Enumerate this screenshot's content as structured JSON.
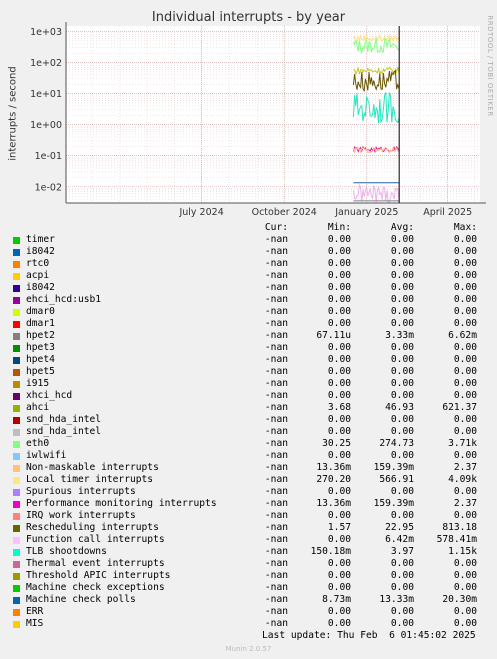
{
  "colors": {
    "background": "#f0f0f0",
    "plot_bg": "#ffffff",
    "grid_minor": "#e6c8c8",
    "grid_major": "#c8a0a0",
    "axis": "#555555",
    "now_line": "#000000"
  },
  "chart_data": {
    "type": "line",
    "title": "Individual interrupts - by year",
    "ylabel": "interrupts / second",
    "yscale": "log",
    "ylim": [
      0.003,
      1500
    ],
    "y_ticks": [
      "1e+03",
      "1e+02",
      "1e+01",
      "1e+00",
      "1e-01",
      "1e-02"
    ],
    "y_tick_values": [
      1000,
      100,
      10,
      1,
      0.1,
      0.01
    ],
    "x_ticks": [
      "July 2024",
      "October 2024",
      "January 2025",
      "April 2025"
    ],
    "x_tick_dates": [
      "2024-07-01",
      "2024-10-01",
      "2025-01-01",
      "2025-04-01"
    ],
    "xlim": [
      "2024-02-01",
      "2025-05-07"
    ],
    "data_start": "2024-12-17",
    "now": "2025-02-06",
    "grid": true,
    "series": [
      {
        "name": "eth0",
        "color": "#80ff80",
        "level": 350,
        "amp": 0.25
      },
      {
        "name": "ahci",
        "color": "#c8c830",
        "level": 55,
        "amp": 0.12
      },
      {
        "name": "Local timer interrupts",
        "color": "#ffe080",
        "level": 600,
        "amp": 0.1
      },
      {
        "name": "Rescheduling interrupts",
        "color": "#665500",
        "level": 25,
        "amp": 0.35
      },
      {
        "name": "TLB shootdowns",
        "color": "#20e8c0",
        "level": 3.5,
        "amp": 0.5
      },
      {
        "name": "Performance monitoring interrupts",
        "color": "#e020a0",
        "level": 0.16,
        "amp": 0.08
      },
      {
        "name": "Non-maskable interrupts",
        "color": "#ffc090",
        "level": 0.15,
        "amp": 0.08
      },
      {
        "name": "Machine check polls",
        "color": "#2060a0",
        "level": 0.0135,
        "amp": 0.0
      },
      {
        "name": "Function call interrupts",
        "color": "#f0b0f0",
        "level": 0.006,
        "amp": 0.3
      },
      {
        "name": "hpet2",
        "color": "#808080",
        "level": 0.0035,
        "amp": 0.0
      }
    ]
  },
  "legend": {
    "headers": {
      "cur": "Cur:",
      "min": "Min:",
      "avg": "Avg:",
      "max": "Max:"
    },
    "rows": [
      {
        "name": "timer",
        "color": "#00cc00",
        "cur": "-nan",
        "min": "0.00",
        "avg": "0.00",
        "max": "0.00"
      },
      {
        "name": "i8042",
        "color": "#0066b3",
        "cur": "-nan",
        "min": "0.00",
        "avg": "0.00",
        "max": "0.00"
      },
      {
        "name": "rtc0",
        "color": "#ff8000",
        "cur": "-nan",
        "min": "0.00",
        "avg": "0.00",
        "max": "0.00"
      },
      {
        "name": "acpi",
        "color": "#ffcc00",
        "cur": "-nan",
        "min": "0.00",
        "avg": "0.00",
        "max": "0.00"
      },
      {
        "name": "i8042",
        "color": "#330099",
        "cur": "-nan",
        "min": "0.00",
        "avg": "0.00",
        "max": "0.00"
      },
      {
        "name": "ehci_hcd:usb1",
        "color": "#990099",
        "cur": "-nan",
        "min": "0.00",
        "avg": "0.00",
        "max": "0.00"
      },
      {
        "name": "dmar0",
        "color": "#ccff00",
        "cur": "-nan",
        "min": "0.00",
        "avg": "0.00",
        "max": "0.00"
      },
      {
        "name": "dmar1",
        "color": "#ff0000",
        "cur": "-nan",
        "min": "0.00",
        "avg": "0.00",
        "max": "0.00"
      },
      {
        "name": "hpet2",
        "color": "#808080",
        "cur": "-nan",
        "min": "67.11u",
        "avg": "3.33m",
        "max": "6.62m"
      },
      {
        "name": "hpet3",
        "color": "#008f00",
        "cur": "-nan",
        "min": "0.00",
        "avg": "0.00",
        "max": "0.00"
      },
      {
        "name": "hpet4",
        "color": "#00487d",
        "cur": "-nan",
        "min": "0.00",
        "avg": "0.00",
        "max": "0.00"
      },
      {
        "name": "hpet5",
        "color": "#b35a00",
        "cur": "-nan",
        "min": "0.00",
        "avg": "0.00",
        "max": "0.00"
      },
      {
        "name": "i915",
        "color": "#b38f00",
        "cur": "-nan",
        "min": "0.00",
        "avg": "0.00",
        "max": "0.00"
      },
      {
        "name": "xhci_hcd",
        "color": "#6b006b",
        "cur": "-nan",
        "min": "0.00",
        "avg": "0.00",
        "max": "0.00"
      },
      {
        "name": "ahci",
        "color": "#8fb300",
        "cur": "-nan",
        "min": "3.68",
        "avg": "46.93",
        "max": "621.37"
      },
      {
        "name": "snd_hda_intel",
        "color": "#b30000",
        "cur": "-nan",
        "min": "0.00",
        "avg": "0.00",
        "max": "0.00"
      },
      {
        "name": "snd_hda_intel",
        "color": "#bebebe",
        "cur": "-nan",
        "min": "0.00",
        "avg": "0.00",
        "max": "0.00"
      },
      {
        "name": "eth0",
        "color": "#80ff80",
        "cur": "-nan",
        "min": "30.25",
        "avg": "274.73",
        "max": "3.71k"
      },
      {
        "name": "iwlwifi",
        "color": "#80c9ff",
        "cur": "-nan",
        "min": "0.00",
        "avg": "0.00",
        "max": "0.00"
      },
      {
        "name": "Non-maskable interrupts",
        "color": "#ffc080",
        "cur": "-nan",
        "min": "13.36m",
        "avg": "159.39m",
        "max": "2.37"
      },
      {
        "name": "Local timer interrupts",
        "color": "#ffe680",
        "cur": "-nan",
        "min": "270.20",
        "avg": "566.91",
        "max": "4.09k"
      },
      {
        "name": "Spurious interrupts",
        "color": "#aa80ff",
        "cur": "-nan",
        "min": "0.00",
        "avg": "0.00",
        "max": "0.00"
      },
      {
        "name": "Performance monitoring interrupts",
        "color": "#ee00cc",
        "cur": "-nan",
        "min": "13.36m",
        "avg": "159.39m",
        "max": "2.37"
      },
      {
        "name": "IRQ work interrupts",
        "color": "#ff8080",
        "cur": "-nan",
        "min": "0.00",
        "avg": "0.00",
        "max": "0.00"
      },
      {
        "name": "Rescheduling interrupts",
        "color": "#666600",
        "cur": "-nan",
        "min": "1.57",
        "avg": "22.95",
        "max": "813.18"
      },
      {
        "name": "Function call interrupts",
        "color": "#ffbfff",
        "cur": "-nan",
        "min": "0.00",
        "avg": "6.42m",
        "max": "578.41m"
      },
      {
        "name": "TLB shootdowns",
        "color": "#00ffcc",
        "cur": "-nan",
        "min": "150.18m",
        "avg": "3.97",
        "max": "1.15k"
      },
      {
        "name": "Thermal event interrupts",
        "color": "#cc6699",
        "cur": "-nan",
        "min": "0.00",
        "avg": "0.00",
        "max": "0.00"
      },
      {
        "name": "Threshold APIC interrupts",
        "color": "#999900",
        "cur": "-nan",
        "min": "0.00",
        "avg": "0.00",
        "max": "0.00"
      },
      {
        "name": "Machine check exceptions",
        "color": "#00cc00",
        "cur": "-nan",
        "min": "0.00",
        "avg": "0.00",
        "max": "0.00"
      },
      {
        "name": "Machine check polls",
        "color": "#0066b3",
        "cur": "-nan",
        "min": "8.73m",
        "avg": "13.33m",
        "max": "20.30m"
      },
      {
        "name": "ERR",
        "color": "#ff8000",
        "cur": "-nan",
        "min": "0.00",
        "avg": "0.00",
        "max": "0.00"
      },
      {
        "name": "MIS",
        "color": "#ffcc00",
        "cur": "-nan",
        "min": "0.00",
        "avg": "0.00",
        "max": "0.00"
      }
    ]
  },
  "last_update": "Last update: Thu Feb  6 01:45:02 2025",
  "footer": "Munin 2.0.57",
  "side_note": "RRDTOOL / TOBI OETIKER"
}
